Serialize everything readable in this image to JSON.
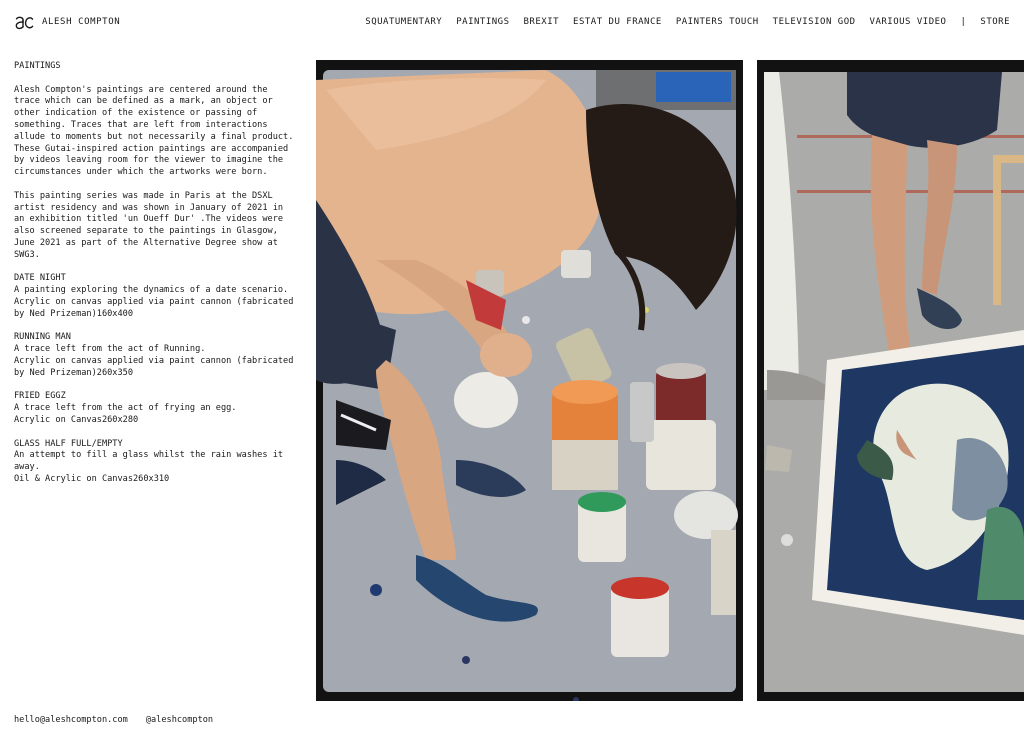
{
  "site": {
    "name": "ALESH COMPTON"
  },
  "nav": {
    "items": [
      "SQUATUMENTARY",
      "PAINTINGS",
      "BREXIT",
      "ESTAT DU FRANCE",
      "PAINTERS TOUCH",
      "TELEVISION GOD",
      "VARIOUS VIDEO"
    ],
    "separator": "|",
    "store": "STORE"
  },
  "content": {
    "section_title": "PAINTINGS",
    "intro": "Alesh Compton's paintings are centered around the trace which can be defined as a mark, an object or other indication of the existence or passing of something. Traces that are left from interactions allude to moments but not necessarily a final product. These Gutai-inspired action paintings are accompanied by videos leaving room for the viewer to imagine the circumstances under which the artworks were born.",
    "series": "This painting series was made in Paris at the DSXL artist residency and was shown in January of 2021 in an exhibition titled 'un Oueff Dur' .The videos were also screened separate to the paintings in Glasgow, June 2021 as part of the Alternative Degree show at SWG3.",
    "works": [
      {
        "title": "DATE NIGHT",
        "desc": "A painting exploring the dynamics of a date scenario.",
        "medium": "Acrylic on canvas applied via paint cannon (fabricated by Ned Prizeman)160x400"
      },
      {
        "title": "RUNNING MAN",
        "desc": "A trace left from the act of Running.",
        "medium": "Acrylic on canvas applied via paint cannon (fabricated by Ned Prizeman)260x350"
      },
      {
        "title": "FRIED EGGZ",
        "desc": "A trace left from the act of frying an egg.",
        "medium": "Acrylic on Canvas260x280"
      },
      {
        "title": "GLASS HALF FULL/EMPTY",
        "desc": "An attempt to fill a glass whilst the rain washes it away.",
        "medium": "Oil & Acrylic on Canvas260x310"
      }
    ]
  },
  "footer": {
    "email": "hello@aleshcompton.com",
    "handle": "@aleshcompton"
  },
  "colors": {
    "text": "#1a1a1a",
    "background": "#ffffff",
    "photo_border": "#111111"
  }
}
